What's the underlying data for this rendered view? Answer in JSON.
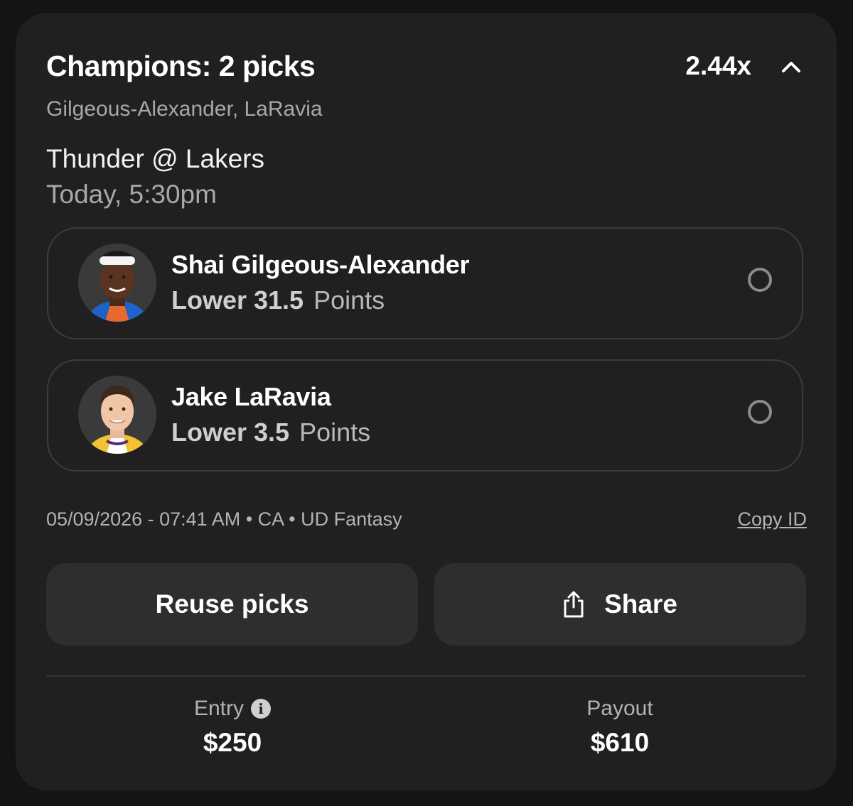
{
  "header": {
    "title": "Champions: 2 picks",
    "multiplier": "2.44x",
    "collapse_icon": "chevron-up-icon"
  },
  "subtitle": "Gilgeous-Alexander, LaRavia",
  "game": {
    "matchup": "Thunder @ Lakers",
    "time": "Today, 5:30pm"
  },
  "picks": [
    {
      "player": "Shai Gilgeous-Alexander",
      "direction_line": "Lower 31.5",
      "stat": "Points",
      "avatar_icon": "player-headshot",
      "jersey_color": "#1e63c9"
    },
    {
      "player": "Jake LaRavia",
      "direction_line": "Lower 3.5",
      "stat": "Points",
      "avatar_icon": "player-headshot",
      "jersey_color": "#f2c231"
    }
  ],
  "meta": {
    "text": "05/09/2026 - 07:41 AM • CA • UD Fantasy",
    "copy_id": "Copy ID"
  },
  "actions": {
    "reuse": "Reuse picks",
    "share": "Share",
    "share_icon": "share-icon"
  },
  "summary": {
    "entry_label": "Entry",
    "entry_value": "$250",
    "payout_label": "Payout",
    "payout_value": "$610",
    "info_icon": "info-icon"
  }
}
